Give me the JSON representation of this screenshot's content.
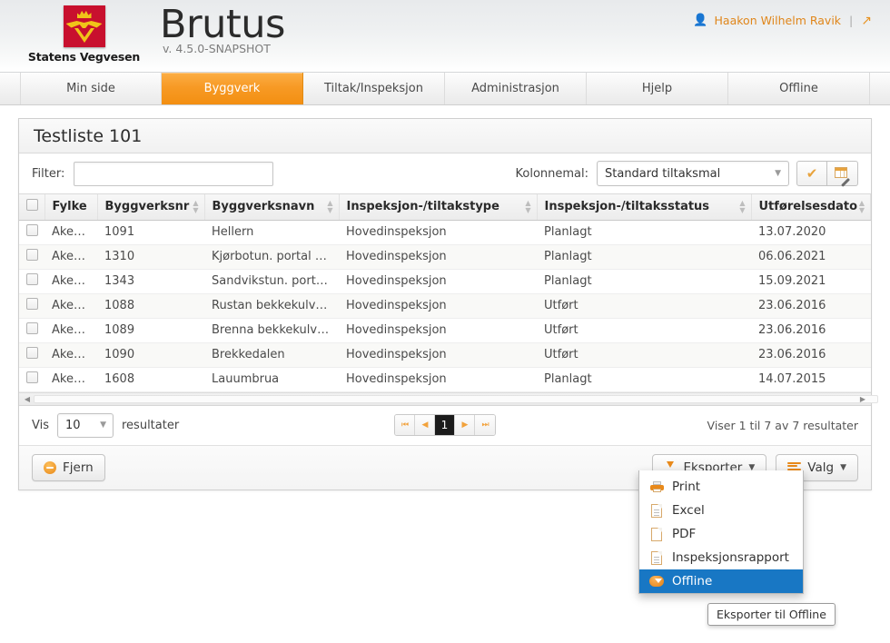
{
  "header": {
    "logo_alt": "Statens Vegvesen",
    "org_name": "Statens Vegvesen",
    "app_title": "Brutus",
    "version": "v. 4.5.0-SNAPSHOT",
    "user_name": "Haakon Wilhelm Ravik",
    "separator": "|",
    "user_icon": "person-icon",
    "expand_icon": "expand-arrows-icon",
    "accent_color": "#e8921f"
  },
  "nav": {
    "items": [
      {
        "label": "Min side",
        "active": false
      },
      {
        "label": "Byggverk",
        "active": true
      },
      {
        "label": "Tiltak/Inspeksjon",
        "active": false
      },
      {
        "label": "Administrasjon",
        "active": false
      },
      {
        "label": "Hjelp",
        "active": false
      },
      {
        "label": "Offline",
        "active": false
      }
    ],
    "active_color": "#f79a25"
  },
  "panel": {
    "title": "Testliste 101"
  },
  "filter": {
    "label": "Filter:",
    "value": "",
    "placeholder": ""
  },
  "kolonnemal": {
    "label": "Kolonnemal:",
    "selected": "Standard tiltaksmal",
    "caret": "▼",
    "apply_icon": "check-icon",
    "apply_glyph": "✔",
    "edit_icon": "table-edit-icon"
  },
  "table": {
    "columns": [
      {
        "key": "check",
        "label": ""
      },
      {
        "key": "fylke",
        "label": "Fylke",
        "sortable": true
      },
      {
        "key": "byggverksnr",
        "label": "Byggverksnr",
        "sortable": true
      },
      {
        "key": "byggverksnavn",
        "label": "Byggverksnavn",
        "sortable": true
      },
      {
        "key": "type",
        "label": "Inspeksjon-/tiltakstype",
        "sortable": true
      },
      {
        "key": "status",
        "label": "Inspeksjon-/tiltaksstatus",
        "sortable": true
      },
      {
        "key": "dato",
        "label": "Utførelsesdato",
        "sortable": true
      }
    ],
    "rows": [
      {
        "fylke": "Akersh...",
        "byggverksnr": "1091",
        "byggverksnavn": "Hellern",
        "type": "Hovedinspeksjon",
        "status": "Planlagt",
        "dato": "13.07.2020"
      },
      {
        "fylke": "Akersh...",
        "byggverksnr": "1310",
        "byggverksnavn": "Kjørbotun. portal nord",
        "type": "Hovedinspeksjon",
        "status": "Planlagt",
        "dato": "06.06.2021"
      },
      {
        "fylke": "Akersh...",
        "byggverksnr": "1343",
        "byggverksnavn": "Sandvikstun. portal n...",
        "type": "Hovedinspeksjon",
        "status": "Planlagt",
        "dato": "15.09.2021"
      },
      {
        "fylke": "Akersh...",
        "byggverksnr": "1088",
        "byggverksnavn": "Rustan bekkekulvert",
        "type": "Hovedinspeksjon",
        "status": "Utført",
        "dato": "23.06.2016"
      },
      {
        "fylke": "Akersh...",
        "byggverksnr": "1089",
        "byggverksnavn": "Brenna bekkekulvert",
        "type": "Hovedinspeksjon",
        "status": "Utført",
        "dato": "23.06.2016"
      },
      {
        "fylke": "Akersh...",
        "byggverksnr": "1090",
        "byggverksnavn": "Brekkedalen",
        "type": "Hovedinspeksjon",
        "status": "Utført",
        "dato": "23.06.2016"
      },
      {
        "fylke": "Akersh...",
        "byggverksnr": "1608",
        "byggverksnavn": "Lauumbrua",
        "type": "Hovedinspeksjon",
        "status": "Planlagt",
        "dato": "14.07.2015"
      }
    ]
  },
  "pager": {
    "show_label": "Vis",
    "page_length": "10",
    "results_label": "resultater",
    "caret": "▼",
    "first_label": "⏮",
    "prev_label": "◀",
    "current_page": "1",
    "next_label": "▶",
    "last_label": "⏭",
    "info": "Viser 1 til 7 av 7 resultater"
  },
  "actions": {
    "remove_label": "Fjern",
    "remove_icon": "minus-circle-icon",
    "export_label": "Eksporter",
    "export_icon": "download-icon",
    "options_label": "Valg",
    "options_icon": "list-bars-icon",
    "caret": "▼"
  },
  "export_menu": {
    "items": [
      {
        "label": "Print",
        "icon": "printer-icon",
        "highlighted": false
      },
      {
        "label": "Excel",
        "icon": "document-icon",
        "highlighted": false
      },
      {
        "label": "PDF",
        "icon": "blank-document-icon",
        "highlighted": false
      },
      {
        "label": "Inspeksjonsrapport",
        "icon": "document-icon",
        "highlighted": false
      },
      {
        "label": "Offline",
        "icon": "cloud-download-icon",
        "highlighted": true
      }
    ],
    "highlight_color": "#1877c4"
  },
  "tooltip": {
    "text": "Eksporter til Offline"
  }
}
